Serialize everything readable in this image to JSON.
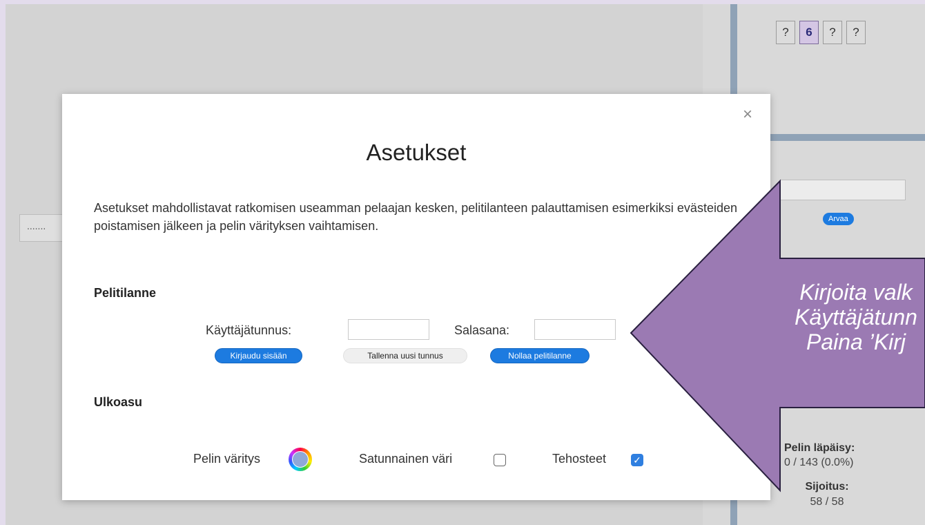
{
  "background": {
    "tiles": [
      "?",
      "6",
      "?",
      "?"
    ],
    "guess_button": "Arvaa",
    "left_box_text": ".......",
    "stats": {
      "label": "Pelin läpäisy:",
      "value": "0 / 143 (0.0%)"
    },
    "rank": {
      "label": "Sijoitus:",
      "value": "58 / 58"
    }
  },
  "modal": {
    "close_glyph": "×",
    "title": "Asetukset",
    "intro": "Asetukset mahdollistavat ratkomisen useamman pelaajan kesken, pelitilanteen palauttamisen esimerkiksi evästeiden poistamisen jälkeen ja pelin värityksen vaihtamisen.",
    "game_state": {
      "heading": "Pelitilanne",
      "username_label": "Käyttäjätunnus:",
      "username_value": "",
      "password_label": "Salasana:",
      "password_value": "",
      "login_button": "Kirjaudu sisään",
      "save_button": "Tallenna uusi tunnus",
      "reset_button": "Nollaa pelitilanne"
    },
    "appearance": {
      "heading": "Ulkoasu",
      "color_label": "Pelin väritys",
      "color_icon": "color-wheel-icon",
      "random_color_label": "Satunnainen väri",
      "random_color_checked": false,
      "effects_label": "Tehosteet",
      "effects_checked": true
    }
  },
  "callout": {
    "line1": "Kirjoita valk",
    "line2": "Käyttäjätunn",
    "line3": "Paina ’Kirj",
    "fill_color": "#9b7ab3"
  }
}
